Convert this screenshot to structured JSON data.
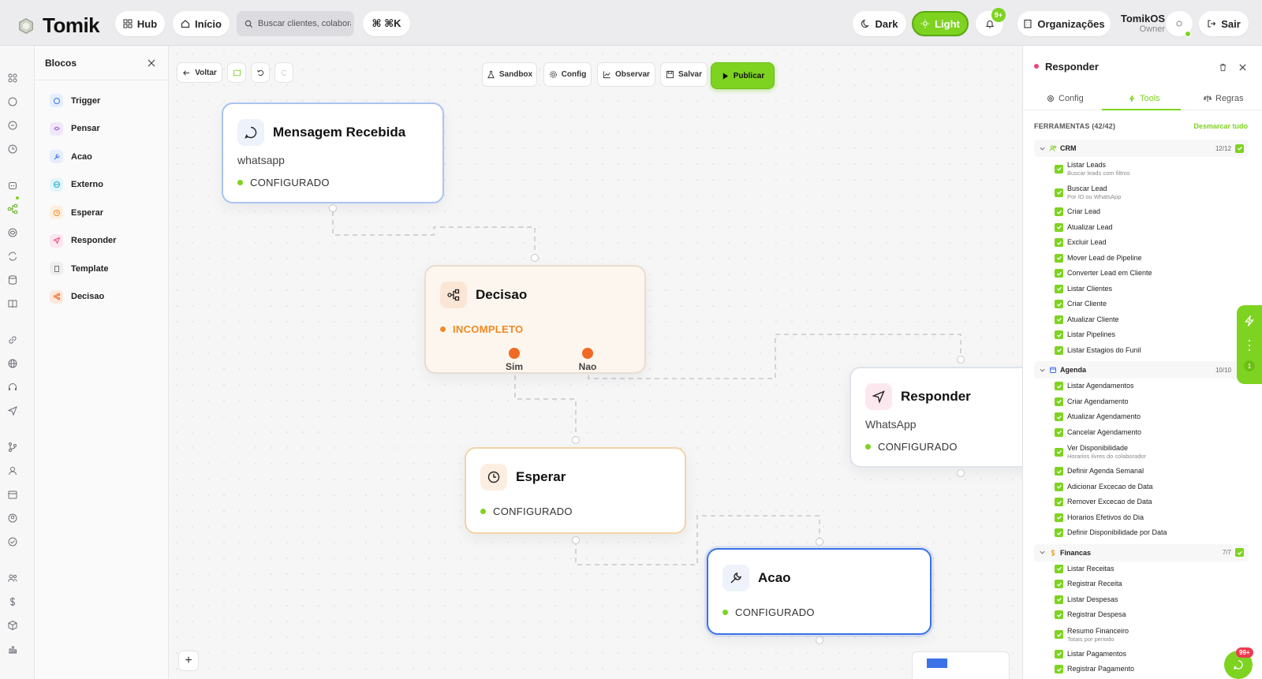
{
  "app": {
    "name": "Tomik"
  },
  "topbar": {
    "hub_label": "Hub",
    "inicio_label": "Início",
    "search_placeholder": "Buscar clientes, colaboradores",
    "shortcut_label": "⌘ ⌘K",
    "dark_label": "Dark",
    "light_label": "Light",
    "notif_count": "9+",
    "org_label": "Organizações",
    "user_name": "TomikOS",
    "user_role": "Owner",
    "logout_label": "Sair"
  },
  "blocks_panel": {
    "title": "Blocos",
    "items": [
      {
        "label": "Trigger",
        "icon": "message-icon",
        "color": "#3b72e8"
      },
      {
        "label": "Pensar",
        "icon": "brain-icon",
        "color": "#9b59d6"
      },
      {
        "label": "Acao",
        "icon": "wrench-icon",
        "color": "#3b72e8"
      },
      {
        "label": "Externo",
        "icon": "globe-icon",
        "color": "#1fa9c9"
      },
      {
        "label": "Esperar",
        "icon": "clock-icon",
        "color": "#f08a24"
      },
      {
        "label": "Responder",
        "icon": "send-icon",
        "color": "#ef4477"
      },
      {
        "label": "Template",
        "icon": "document-icon",
        "color": "#777777"
      },
      {
        "label": "Decisao",
        "icon": "branch-icon",
        "color": "#f06a24"
      }
    ]
  },
  "canvas_toolbar": {
    "back_label": "Voltar",
    "sandbox_label": "Sandbox",
    "config_label": "Config",
    "observe_label": "Observar",
    "save_label": "Salvar",
    "publish_label": "Publicar"
  },
  "nodes": {
    "mensagem": {
      "title": "Mensagem Recebida",
      "sub": "whatsapp",
      "status": "CONFIGURADO"
    },
    "decisao": {
      "title": "Decisao",
      "status": "INCOMPLETO",
      "out_yes": "Sim",
      "out_no": "Nao"
    },
    "responder": {
      "title": "Responder",
      "sub": "WhatsApp",
      "status": "CONFIGURADO"
    },
    "esperar": {
      "title": "Esperar",
      "status": "CONFIGURADO"
    },
    "acao": {
      "title": "Acao",
      "status": "CONFIGURADO"
    }
  },
  "zoom_label": "+",
  "right_panel": {
    "title": "Responder",
    "tabs": [
      "Config",
      "Tools",
      "Regras"
    ],
    "active_tab": "Tools",
    "tools_header": "FERRAMENTAS (42/42)",
    "deselect_label": "Desmarcar tudo",
    "groups": [
      {
        "name": "CRM",
        "count": "12/12",
        "tools": [
          {
            "name": "Listar Leads",
            "desc": "Buscar leads com filtros"
          },
          {
            "name": "Buscar Lead",
            "desc": "Por ID ou WhatsApp"
          },
          {
            "name": "Criar Lead",
            "desc": ""
          },
          {
            "name": "Atualizar Lead",
            "desc": ""
          },
          {
            "name": "Excluir Lead",
            "desc": ""
          },
          {
            "name": "Mover Lead de Pipeline",
            "desc": ""
          },
          {
            "name": "Converter Lead em Cliente",
            "desc": ""
          },
          {
            "name": "Listar Clientes",
            "desc": ""
          },
          {
            "name": "Criar Cliente",
            "desc": ""
          },
          {
            "name": "Atualizar Cliente",
            "desc": ""
          },
          {
            "name": "Listar Pipelines",
            "desc": ""
          },
          {
            "name": "Listar Estagios do Funil",
            "desc": ""
          }
        ]
      },
      {
        "name": "Agenda",
        "count": "10/10",
        "tools": [
          {
            "name": "Listar Agendamentos",
            "desc": ""
          },
          {
            "name": "Criar Agendamento",
            "desc": ""
          },
          {
            "name": "Atualizar Agendamento",
            "desc": ""
          },
          {
            "name": "Cancelar Agendamento",
            "desc": ""
          },
          {
            "name": "Ver Disponibilidade",
            "desc": "Horarios livres do colaborador"
          },
          {
            "name": "Definir Agenda Semanal",
            "desc": ""
          },
          {
            "name": "Adicionar Excecao de Data",
            "desc": ""
          },
          {
            "name": "Remover Excecao de Data",
            "desc": ""
          },
          {
            "name": "Horarios Efetivos do Dia",
            "desc": ""
          },
          {
            "name": "Definir Disponibilidade por Data",
            "desc": ""
          }
        ]
      },
      {
        "name": "Financas",
        "count": "7/7",
        "tools": [
          {
            "name": "Listar Receitas",
            "desc": ""
          },
          {
            "name": "Registrar Receita",
            "desc": ""
          },
          {
            "name": "Listar Despesas",
            "desc": ""
          },
          {
            "name": "Registrar Despesa",
            "desc": ""
          },
          {
            "name": "Resumo Financeiro",
            "desc": "Totais por periodo"
          },
          {
            "name": "Listar Pagamentos",
            "desc": ""
          },
          {
            "name": "Registrar Pagamento",
            "desc": ""
          }
        ]
      }
    ]
  },
  "side_flag_count": "1",
  "chat_badge": "99+",
  "colors": {
    "accent": "#7ed321",
    "warning": "#f08a24",
    "danger": "#ef3b4f",
    "selected": "#3b72e8"
  }
}
